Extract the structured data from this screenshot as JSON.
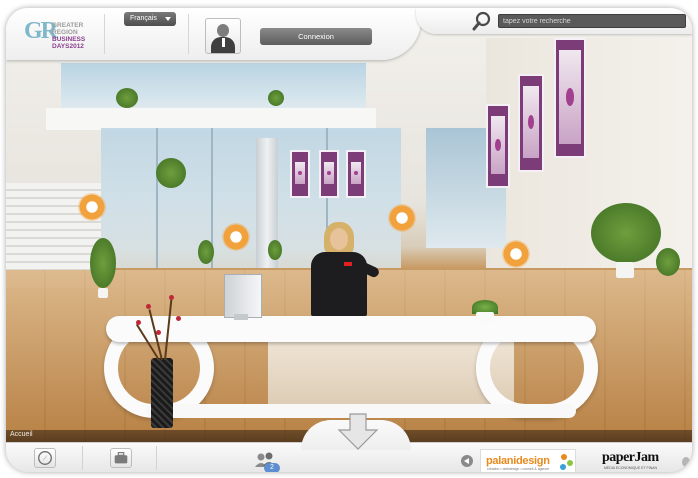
{
  "header": {
    "logo": {
      "mark": "GR",
      "line1": "GREATER",
      "line2": "REGION",
      "line3": "BUSINESS",
      "line4": "DAYS2012"
    },
    "language": {
      "selected": "Français",
      "icon": "chevron-down-icon"
    },
    "user": {
      "avatar_icon": "user-avatar-icon"
    },
    "login_label": "Connexion",
    "search": {
      "icon": "search-icon",
      "placeholder": "tapez votre recherche"
    }
  },
  "scene": {
    "hotspot_icon": "hotspot-icon",
    "accent_color": "#f2a23c"
  },
  "breadcrumb": {
    "current": "Accueil"
  },
  "footer": {
    "compass_icon": "compass-icon",
    "briefcase_icon": "briefcase-icon",
    "users_icon": "users-icon",
    "online_count": "2",
    "prev_icon": "chevron-left-icon",
    "down_arrow_icon": "down-arrow-icon",
    "sponsors": [
      {
        "name": "palanidesign",
        "tagline": "création • webdesign • conseil & agence",
        "color": "#e88a1c"
      },
      {
        "name": "paperJam",
        "tagline": "MEDIA ECONOMIQUE ET FINAN"
      }
    ]
  }
}
